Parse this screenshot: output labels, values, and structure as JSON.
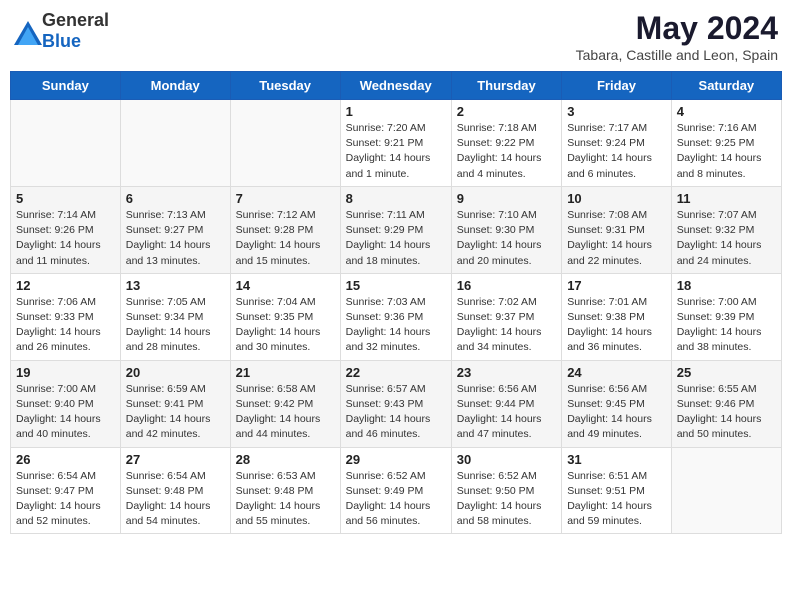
{
  "header": {
    "logo_general": "General",
    "logo_blue": "Blue",
    "title": "May 2024",
    "subtitle": "Tabara, Castille and Leon, Spain"
  },
  "weekdays": [
    "Sunday",
    "Monday",
    "Tuesday",
    "Wednesday",
    "Thursday",
    "Friday",
    "Saturday"
  ],
  "weeks": [
    [
      {
        "day": "",
        "info": ""
      },
      {
        "day": "",
        "info": ""
      },
      {
        "day": "",
        "info": ""
      },
      {
        "day": "1",
        "info": "Sunrise: 7:20 AM\nSunset: 9:21 PM\nDaylight: 14 hours\nand 1 minute."
      },
      {
        "day": "2",
        "info": "Sunrise: 7:18 AM\nSunset: 9:22 PM\nDaylight: 14 hours\nand 4 minutes."
      },
      {
        "day": "3",
        "info": "Sunrise: 7:17 AM\nSunset: 9:24 PM\nDaylight: 14 hours\nand 6 minutes."
      },
      {
        "day": "4",
        "info": "Sunrise: 7:16 AM\nSunset: 9:25 PM\nDaylight: 14 hours\nand 8 minutes."
      }
    ],
    [
      {
        "day": "5",
        "info": "Sunrise: 7:14 AM\nSunset: 9:26 PM\nDaylight: 14 hours\nand 11 minutes."
      },
      {
        "day": "6",
        "info": "Sunrise: 7:13 AM\nSunset: 9:27 PM\nDaylight: 14 hours\nand 13 minutes."
      },
      {
        "day": "7",
        "info": "Sunrise: 7:12 AM\nSunset: 9:28 PM\nDaylight: 14 hours\nand 15 minutes."
      },
      {
        "day": "8",
        "info": "Sunrise: 7:11 AM\nSunset: 9:29 PM\nDaylight: 14 hours\nand 18 minutes."
      },
      {
        "day": "9",
        "info": "Sunrise: 7:10 AM\nSunset: 9:30 PM\nDaylight: 14 hours\nand 20 minutes."
      },
      {
        "day": "10",
        "info": "Sunrise: 7:08 AM\nSunset: 9:31 PM\nDaylight: 14 hours\nand 22 minutes."
      },
      {
        "day": "11",
        "info": "Sunrise: 7:07 AM\nSunset: 9:32 PM\nDaylight: 14 hours\nand 24 minutes."
      }
    ],
    [
      {
        "day": "12",
        "info": "Sunrise: 7:06 AM\nSunset: 9:33 PM\nDaylight: 14 hours\nand 26 minutes."
      },
      {
        "day": "13",
        "info": "Sunrise: 7:05 AM\nSunset: 9:34 PM\nDaylight: 14 hours\nand 28 minutes."
      },
      {
        "day": "14",
        "info": "Sunrise: 7:04 AM\nSunset: 9:35 PM\nDaylight: 14 hours\nand 30 minutes."
      },
      {
        "day": "15",
        "info": "Sunrise: 7:03 AM\nSunset: 9:36 PM\nDaylight: 14 hours\nand 32 minutes."
      },
      {
        "day": "16",
        "info": "Sunrise: 7:02 AM\nSunset: 9:37 PM\nDaylight: 14 hours\nand 34 minutes."
      },
      {
        "day": "17",
        "info": "Sunrise: 7:01 AM\nSunset: 9:38 PM\nDaylight: 14 hours\nand 36 minutes."
      },
      {
        "day": "18",
        "info": "Sunrise: 7:00 AM\nSunset: 9:39 PM\nDaylight: 14 hours\nand 38 minutes."
      }
    ],
    [
      {
        "day": "19",
        "info": "Sunrise: 7:00 AM\nSunset: 9:40 PM\nDaylight: 14 hours\nand 40 minutes."
      },
      {
        "day": "20",
        "info": "Sunrise: 6:59 AM\nSunset: 9:41 PM\nDaylight: 14 hours\nand 42 minutes."
      },
      {
        "day": "21",
        "info": "Sunrise: 6:58 AM\nSunset: 9:42 PM\nDaylight: 14 hours\nand 44 minutes."
      },
      {
        "day": "22",
        "info": "Sunrise: 6:57 AM\nSunset: 9:43 PM\nDaylight: 14 hours\nand 46 minutes."
      },
      {
        "day": "23",
        "info": "Sunrise: 6:56 AM\nSunset: 9:44 PM\nDaylight: 14 hours\nand 47 minutes."
      },
      {
        "day": "24",
        "info": "Sunrise: 6:56 AM\nSunset: 9:45 PM\nDaylight: 14 hours\nand 49 minutes."
      },
      {
        "day": "25",
        "info": "Sunrise: 6:55 AM\nSunset: 9:46 PM\nDaylight: 14 hours\nand 50 minutes."
      }
    ],
    [
      {
        "day": "26",
        "info": "Sunrise: 6:54 AM\nSunset: 9:47 PM\nDaylight: 14 hours\nand 52 minutes."
      },
      {
        "day": "27",
        "info": "Sunrise: 6:54 AM\nSunset: 9:48 PM\nDaylight: 14 hours\nand 54 minutes."
      },
      {
        "day": "28",
        "info": "Sunrise: 6:53 AM\nSunset: 9:48 PM\nDaylight: 14 hours\nand 55 minutes."
      },
      {
        "day": "29",
        "info": "Sunrise: 6:52 AM\nSunset: 9:49 PM\nDaylight: 14 hours\nand 56 minutes."
      },
      {
        "day": "30",
        "info": "Sunrise: 6:52 AM\nSunset: 9:50 PM\nDaylight: 14 hours\nand 58 minutes."
      },
      {
        "day": "31",
        "info": "Sunrise: 6:51 AM\nSunset: 9:51 PM\nDaylight: 14 hours\nand 59 minutes."
      },
      {
        "day": "",
        "info": ""
      }
    ]
  ]
}
